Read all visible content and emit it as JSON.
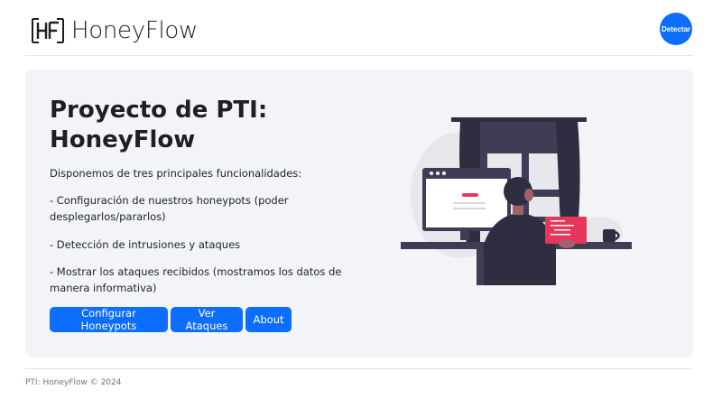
{
  "header": {
    "brand_name": "HoneyFlow",
    "logo_icon": "hf-logo-icon",
    "detect_label": "Detectar"
  },
  "hero": {
    "title": "Proyecto de PTI: HoneyFlow",
    "intro": "Disponemos de tres principales funcionalidades:",
    "features": [
      "- Configuración de nuestros honeypots (poder desplegarlos/pararlos)",
      "- Detección de intrusiones y ataques",
      "- Mostrar los ataques recibidos (mostramos los datos de manera informativa)"
    ],
    "buttons": {
      "configure": "Configurar Honeypots",
      "attacks": "Ver Ataques",
      "about": "About"
    },
    "illustration_icon": "hacker-at-computer-illustration"
  },
  "footer": {
    "text": "PTI: HoneyFlow © 2024"
  },
  "colors": {
    "primary": "#0d6efd",
    "hero_bg": "#f2f4f7",
    "accent_red": "#e8365b",
    "dark": "#2f2e41"
  }
}
